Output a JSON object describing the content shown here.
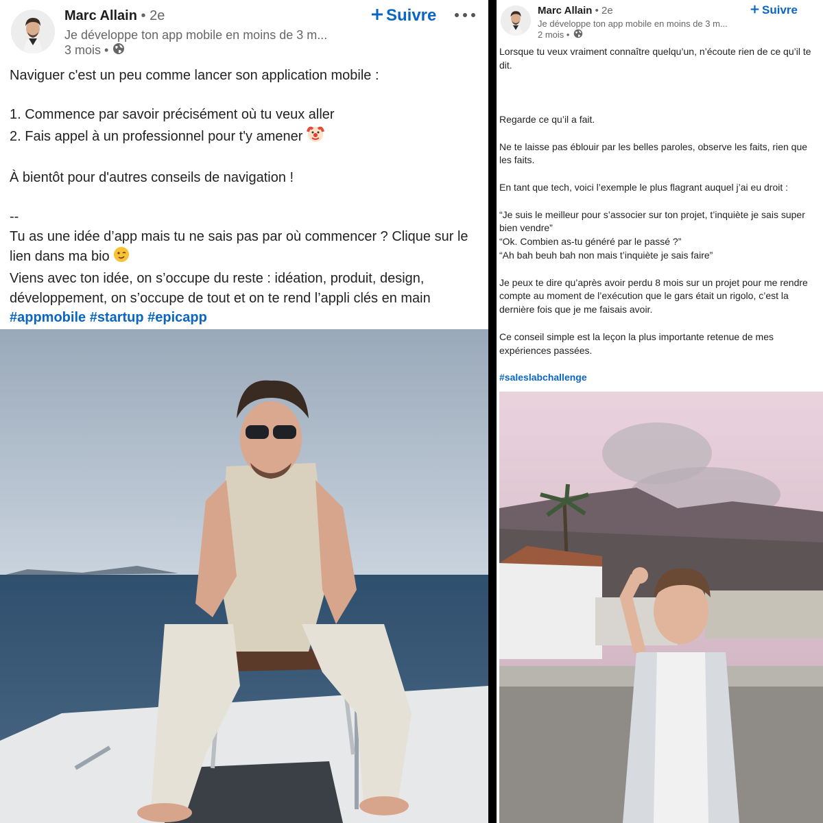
{
  "posts": [
    {
      "author": "Marc Allain",
      "degree": "• 2e",
      "headline": "Je développe ton app mobile en moins de 3 m...",
      "time": "3 mois •",
      "follow_label": "Suivre",
      "body_intro": "Naviguer c'est un peu comme lancer son application mobile :",
      "list_item_1": "1. Commence par savoir précisément où tu veux aller",
      "list_item_2": "2. Fais appel à un professionnel pour t'y amener",
      "closing": "À bientôt pour d'autres conseils de navigation !",
      "separator": "--",
      "cta": "Tu as une idée d’app mais tu ne sais pas par où commencer ? Clique sur le lien dans ma bio",
      "offer": "Viens avec ton idée, on s’occupe du reste : idéation, produit, design, développement, on s’occupe de tout et on te rend l’appli clés en main",
      "hashtags": "#appmobile #startup #epicapp",
      "icons": [
        "avatar",
        "plus-icon",
        "more-icon",
        "globe-icon",
        "clown-emoji",
        "wink-emoji"
      ],
      "photo_alt": "Man in sunglasses sitting on a sailboat seat at sea"
    },
    {
      "author": "Marc Allain",
      "degree": "• 2e",
      "headline": "Je développe ton app mobile en moins de 3 m...",
      "time": "2 mois •",
      "follow_label": "Suivre",
      "p1": "Lorsque tu veux vraiment connaître quelqu’un, n’écoute rien de ce qu’il te dit.",
      "p2": "Regarde ce qu’il a fait.",
      "p3": "Ne te laisse pas éblouir par les belles paroles, observe les faits, rien que les faits.",
      "p4": "En tant que tech, voici l’exemple le plus flagrant auquel j’ai eu droit :",
      "q1": "“Je suis le meilleur pour s’associer sur ton projet, t’inquiète je sais super bien vendre”",
      "q2": "“Ok. Combien as-tu généré par le passé ?”",
      "q3": "“Ah bah beuh bah non mais t’inquiète je sais faire”",
      "p5": "Je peux te dire qu’après avoir perdu 8 mois sur un projet pour me rendre compte au moment de l’exécution que le gars était un rigolo, c’est la dernière fois que je me faisais avoir.",
      "p6": "Ce conseil simple est la leçon la plus importante retenue de mes expériences passées.",
      "hashtags": "#saleslabchallenge",
      "icons": [
        "avatar",
        "plus-icon",
        "globe-icon"
      ],
      "photo_alt": "Man in floral shirt making OK sign on rooftop with volcanic smoke behind"
    }
  ],
  "colors": {
    "link": "#0a66c2",
    "muted": "#666666",
    "text": "#222222",
    "divider": "#000000"
  }
}
